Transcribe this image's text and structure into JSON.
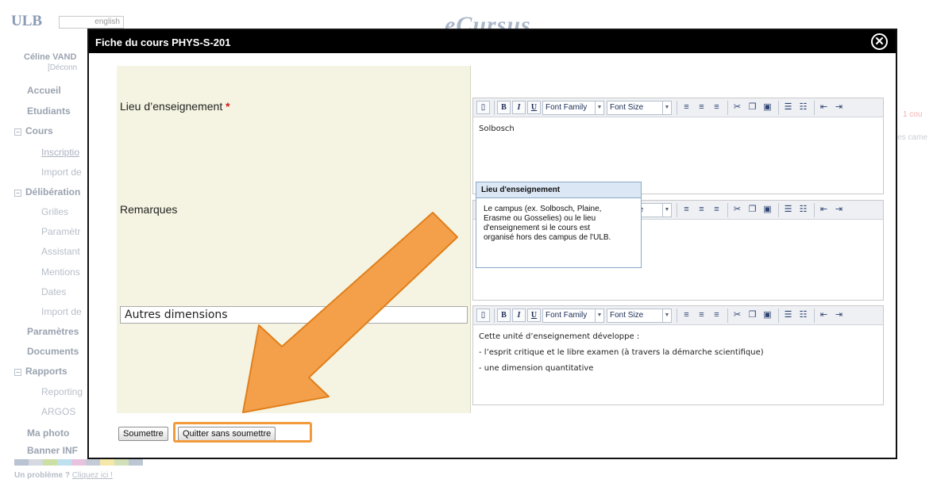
{
  "background": {
    "logo": "ULB",
    "lang": "english",
    "app_title": "eCursus",
    "user": {
      "name": "Céline VAND",
      "logout": "[Déconn"
    },
    "sidebar": {
      "accueil": "Accueil",
      "etudiants": "Etudiants",
      "cours": "Cours",
      "inscription": "Inscriptio",
      "import_de_1": "Import de",
      "deliberation": "Délibération",
      "grilles": "Grilles",
      "parametre": "Paramètr",
      "assistant": "Assistant",
      "mentions": "Mentions",
      "dates": "Dates",
      "import_de_2": "Import de",
      "parametres": "Paramètres",
      "documents": "Documents",
      "rapports": "Rapports",
      "reporting": "Reporting",
      "argos": "ARGOS",
      "ma_photo": "Ma photo",
      "banner": "Banner INF"
    },
    "footer": {
      "problem": "Un problème ?",
      "link": "Cliquez ici !"
    },
    "right_fragments": {
      "cours": "1 cou",
      "cam": "les came"
    }
  },
  "modal": {
    "title": "Fiche du cours PHYS-S-201",
    "close_label": "✕",
    "fields": {
      "lieu_label": "Lieu d’enseignement",
      "required_mark": "*",
      "remarques_label": "Remarques",
      "autres_value": "Autres dimensions"
    },
    "toolbar": {
      "bold": "B",
      "italic": "I",
      "underline": "U",
      "font_family": "Font Family",
      "font_size": "Font Size"
    },
    "editors": {
      "lieu_text": "Solbosch",
      "autres_lines": [
        "Cette unité d’enseignement développe :",
        "- l’esprit critique et le libre examen (à travers la démarche scientifique)",
        "- une dimension quantitative"
      ]
    },
    "tooltip": {
      "title": "Lieu d'enseignement",
      "line1": "Le campus (ex. Solbosch, Plaine,",
      "line2": "Erasme ou Gosselies) ou le lieu",
      "line3": "d'enseignement si le cours est",
      "line4": "organisé hors des campus de l'ULB."
    },
    "buttons": {
      "submit": "Soumettre",
      "quit": "Quitter sans soumettre"
    }
  },
  "colors": {
    "annotation": "#f39a3a",
    "form_bg": "#f5f4e2",
    "titlebar": "#000000"
  }
}
